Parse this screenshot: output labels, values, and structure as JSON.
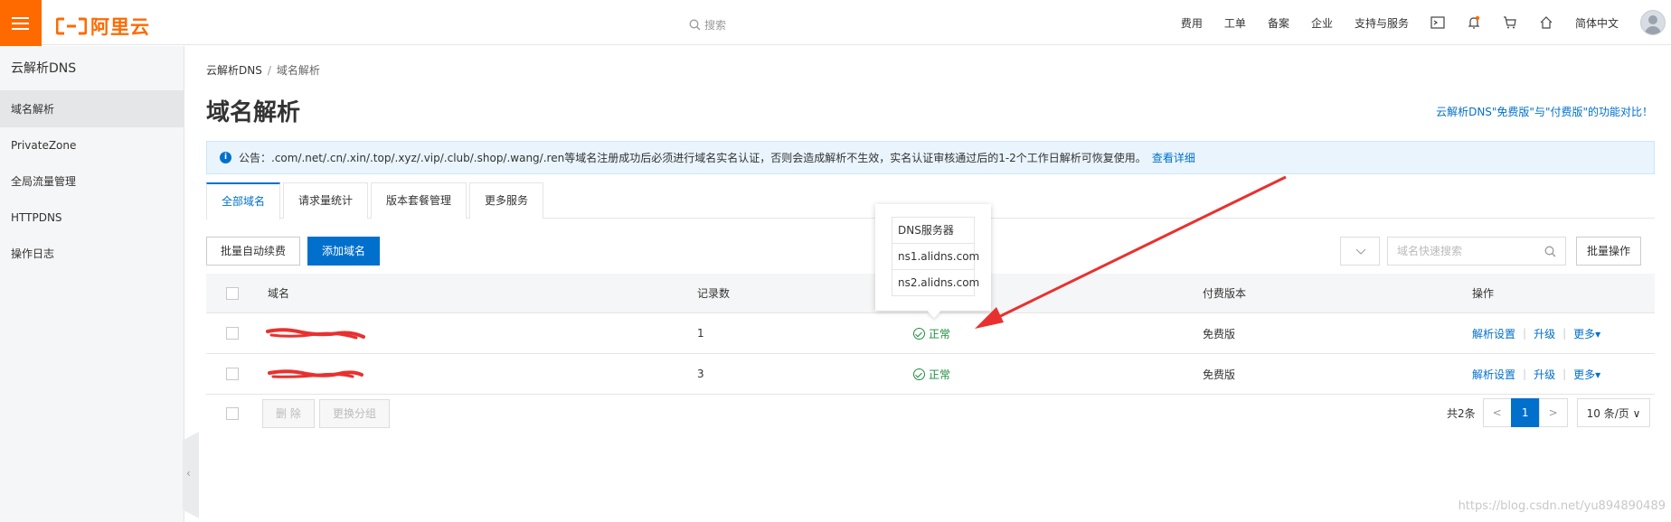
{
  "colors": {
    "brand": "#ff6a00",
    "primary": "#0070cc",
    "success": "#1e8e3e",
    "annotation": "#e8312f"
  },
  "topbar": {
    "menu_icon": "hamburger-icon",
    "logo_text": "阿里云",
    "search_placeholder": "搜索",
    "nav": [
      "费用",
      "工单",
      "备案",
      "企业",
      "支持与服务"
    ],
    "icons": [
      "terminal-icon",
      "bell-icon",
      "cart-icon",
      "home-icon"
    ],
    "language": "简体中文"
  },
  "sidebar": {
    "title": "云解析DNS",
    "items": [
      {
        "label": "域名解析",
        "active": true
      },
      {
        "label": "PrivateZone"
      },
      {
        "label": "全局流量管理"
      },
      {
        "label": "HTTPDNS"
      },
      {
        "label": "操作日志"
      }
    ],
    "collapse_icon": "‹"
  },
  "breadcrumb": {
    "root": "云解析DNS",
    "sep": "/",
    "current": "域名解析"
  },
  "page": {
    "title": "域名解析",
    "compare_link": "云解析DNS\"免费版\"与\"付费版\"的功能对比！"
  },
  "notice": {
    "text": "公告：.com/.net/.cn/.xin/.top/.xyz/.vip/.club/.shop/.wang/.ren等域名注册成功后必须进行域名实名认证，否则会造成解析不生效，实名认证审核通过后的1-2个工作日解析可恢复使用。",
    "link": "查看详细"
  },
  "tabs": [
    "全部域名",
    "请求量统计",
    "版本套餐管理",
    "更多服务"
  ],
  "toolbar": {
    "batch_renew": "批量自动续费",
    "add_domain": "添加域名",
    "search_placeholder": "域名快速搜索",
    "batch_ops": "批量操作"
  },
  "table": {
    "headers": {
      "domain": "域名",
      "records": "记录数",
      "version": "付费版本",
      "ops": "操作"
    },
    "rows": [
      {
        "records": "1",
        "status": "正常",
        "version": "免费版",
        "op1": "解析设置",
        "op2": "升级",
        "op3": "更多▾"
      },
      {
        "records": "3",
        "status": "正常",
        "version": "免费版",
        "op1": "解析设置",
        "op2": "升级",
        "op3": "更多▾"
      }
    ]
  },
  "footer": {
    "delete": "删 除",
    "change_group": "更换分组",
    "total": "共2条",
    "prev": "<",
    "page": "1",
    "next": ">",
    "page_size": "10 条/页 ∨"
  },
  "popover": {
    "title": "DNS服务器",
    "servers": [
      "ns1.alidns.com",
      "ns2.alidns.com"
    ]
  },
  "watermark": "https://blog.csdn.net/yu894890489"
}
